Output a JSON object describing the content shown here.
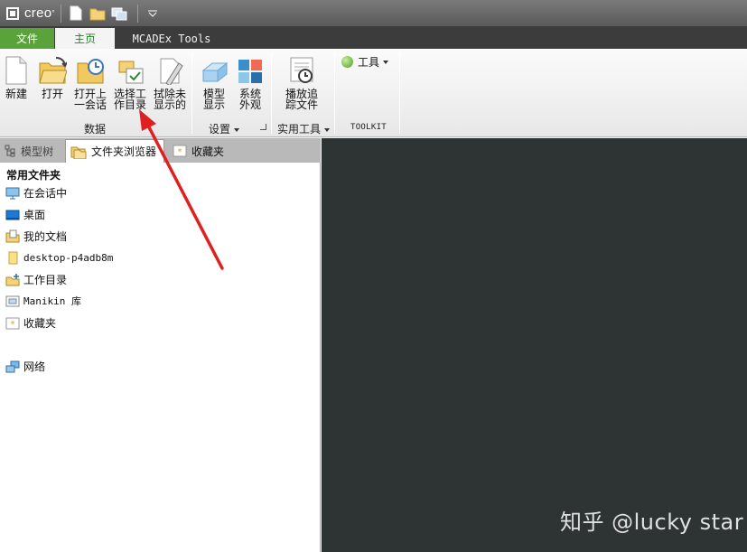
{
  "app": {
    "logo_text": "creo"
  },
  "ribbon_tabs": {
    "file": "文件",
    "home": "主页",
    "mcadex": "MCADEx Tools"
  },
  "ribbon": {
    "new": "新建",
    "open": "打开",
    "open_session": "打开上\n一会话",
    "select_workdir": "选择工\n作目录",
    "erase_undisplayed": "拭除未\n显示的",
    "group_data": "数据",
    "model_display": "模型\n显示",
    "system_appearance": "系统\n外观",
    "group_settings": "设置",
    "play_trail": "播放追\n踪文件",
    "group_utilities": "实用工具",
    "tools": "工具",
    "group_toolkit": "TOOLKIT"
  },
  "panel": {
    "tab_model_tree": "模型树",
    "tab_folder_browser": "文件夹浏览器",
    "tab_favorites": "收藏夹",
    "common_folders": "常用文件夹",
    "items": [
      "在会话中",
      "桌面",
      "我的文档",
      "desktop-p4adb8m",
      "工作目录",
      "Manikin 库",
      "收藏夹",
      "网络"
    ]
  },
  "watermark": "知乎 @lucky star",
  "colors": {
    "file_tab": "#5aa33a",
    "home_tab_text": "#1a8a1a",
    "main_bg": "#2e3333",
    "annotation_arrow": "#e02020"
  }
}
